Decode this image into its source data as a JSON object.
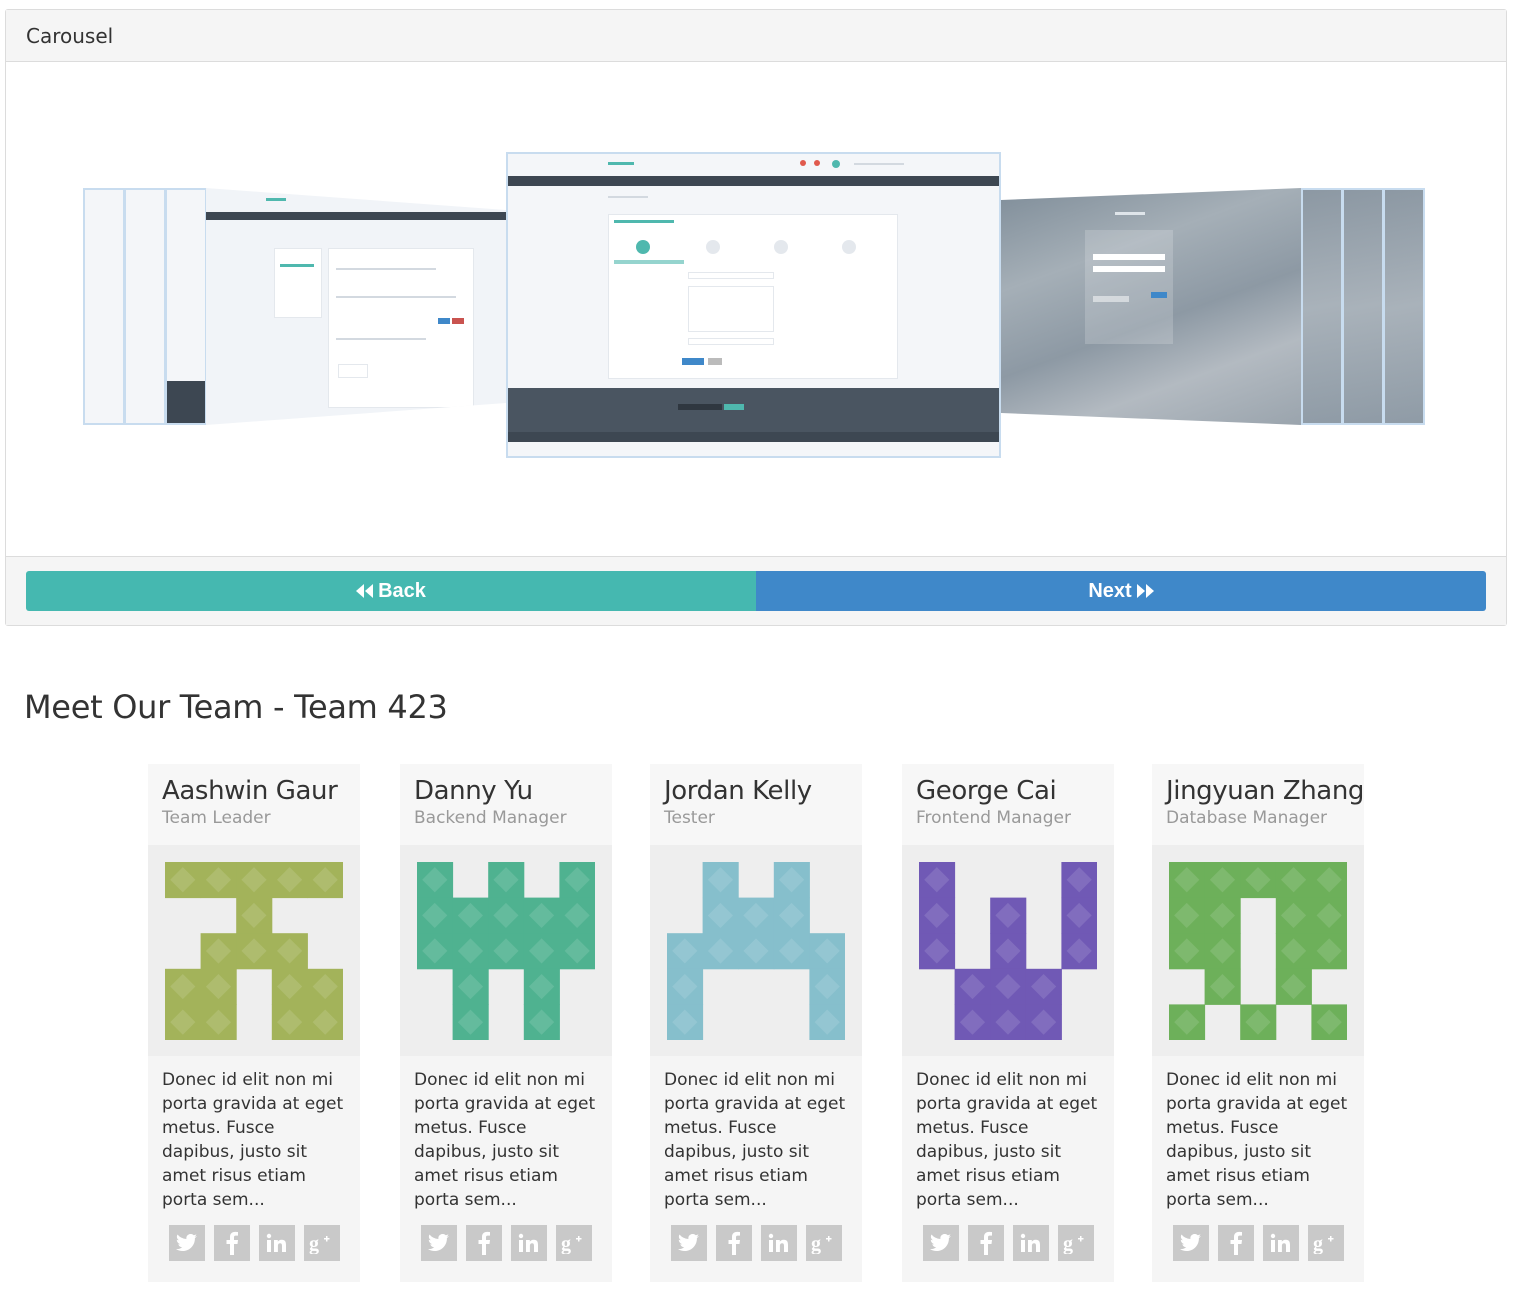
{
  "carousel": {
    "heading": "Carousel",
    "back_label": "Back",
    "next_label": "Next",
    "back_color": "#45b8b0",
    "next_color": "#3f88c9"
  },
  "team": {
    "title": "Meet Our Team - Team 423",
    "members": [
      {
        "name": "Aashwin Gaur",
        "role": "Team Leader",
        "bio": "Donec id elit non mi porta gravida at eget metus. Fusce dapibus, justo sit amet risus etiam porta sem...",
        "avatar_color": "#a3b35a"
      },
      {
        "name": "Danny Yu",
        "role": "Backend Manager",
        "bio": "Donec id elit non mi porta gravida at eget metus. Fusce dapibus, justo sit amet risus etiam porta sem...",
        "avatar_color": "#4fb290"
      },
      {
        "name": "Jordan Kelly",
        "role": "Tester",
        "bio": "Donec id elit non mi porta gravida at eget metus. Fusce dapibus, justo sit amet risus etiam porta sem...",
        "avatar_color": "#86bfcc"
      },
      {
        "name": "George Cai",
        "role": "Frontend Manager",
        "bio": "Donec id elit non mi porta gravida at eget metus. Fusce dapibus, justo sit amet risus etiam porta sem...",
        "avatar_color": "#7059b5"
      },
      {
        "name": "Jingyuan Zhang",
        "role": "Database Manager",
        "bio": "Donec id elit non mi porta gravida at eget metus. Fusce dapibus, justo sit amet risus etiam porta sem...",
        "avatar_color": "#6db05a"
      }
    ],
    "social_icons": [
      "twitter-icon",
      "facebook-icon",
      "linkedin-icon",
      "google-plus-icon"
    ]
  }
}
